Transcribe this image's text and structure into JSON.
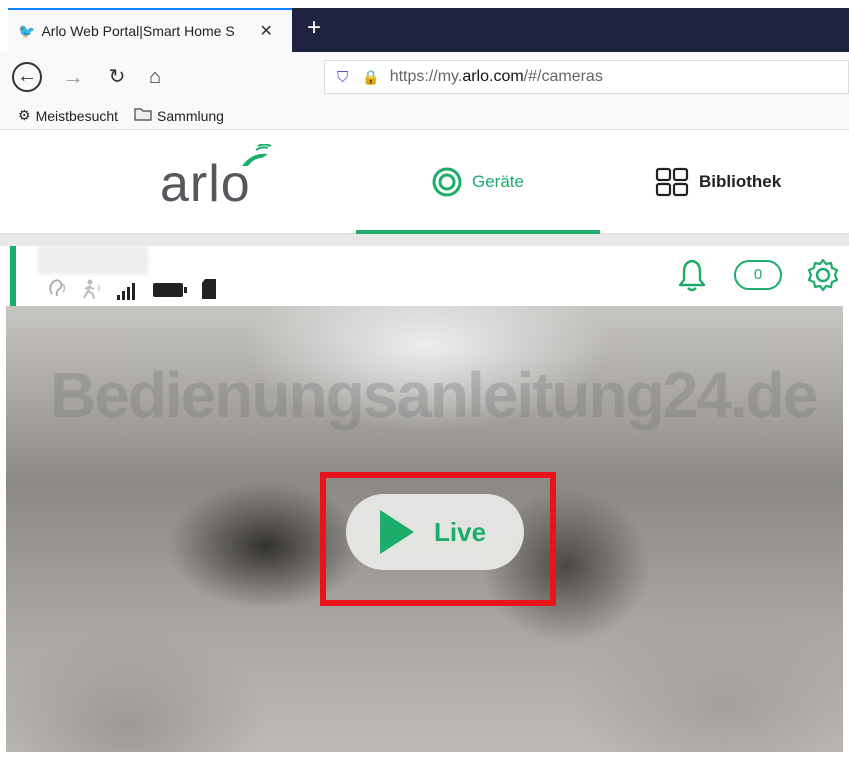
{
  "browser": {
    "tab_title": "Arlo Web Portal|Smart Home S",
    "tab_close": "✕",
    "new_tab": "+",
    "url_prefix": "https://my.",
    "url_domain": "arlo.com",
    "url_suffix": "/#/cameras",
    "bookmarks": [
      {
        "label": "Meistbesucht",
        "icon": "gear-icon"
      },
      {
        "label": "Sammlung",
        "icon": "folder-icon"
      }
    ]
  },
  "arlo": {
    "logo": "arlo",
    "nav": {
      "devices": "Geräte",
      "library": "Bibliothek"
    },
    "notification_count": "0"
  },
  "video": {
    "watermark": "Bedienungsanleitung24.de",
    "live_label": "Live"
  },
  "colors": {
    "accent": "#1cad6b",
    "highlight": "#e8141a",
    "tabbar_dark": "#202340"
  }
}
